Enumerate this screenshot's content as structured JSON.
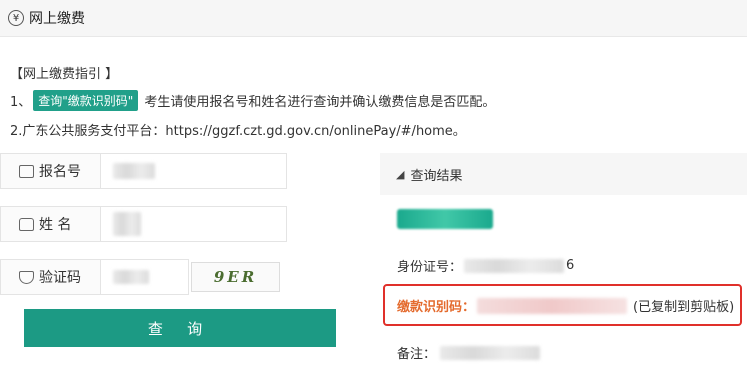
{
  "header": {
    "title": "网上缴费",
    "icon": "yen-icon"
  },
  "guide": {
    "title": "【网上缴费指引 】",
    "step1_prefix": "1、",
    "step1_tag": "查询\"缴款识别码\"",
    "step1_text": "考生请使用报名号和姓名进行查询并确认缴费信息是否匹配。",
    "step2_text": "2.广东公共服务支付平台：https://ggzf.czt.gd.gov.cn/onlinePay/#/home。"
  },
  "form": {
    "reg_label": "报名号",
    "name_label": "姓 名",
    "captcha_label": "验证码",
    "captcha_text": "9ER",
    "query_button": "查 询"
  },
  "result": {
    "title": "查询结果",
    "id_label": "身份证号：",
    "id_suffix": "6",
    "code_label": "缴款识别码：",
    "copied_note": "(已复制到剪贴板)",
    "remark_label": "备注："
  },
  "colors": {
    "accent": "#1c9a84",
    "highlight": "#e0302a",
    "code_label": "#e46b2e"
  }
}
